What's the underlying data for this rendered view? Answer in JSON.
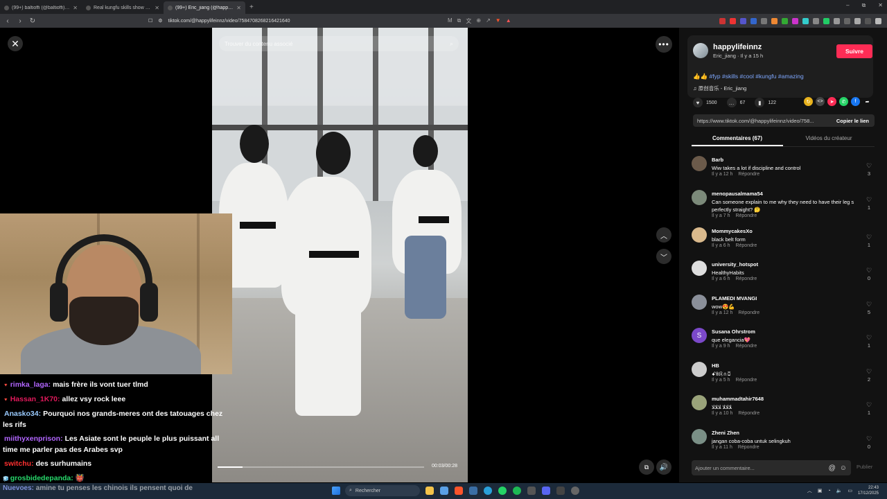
{
  "browser": {
    "tabs": [
      {
        "label": "(99+) baltioffi (@baltioffi) | TikTok",
        "active": false
      },
      {
        "label": "Real kungfu skills show 🥋 #fyp #coo",
        "active": false
      },
      {
        "label": "(99+) Eric_jiang (@happylifeinnz)",
        "active": true
      }
    ],
    "url": "tiktok.com/@happylifeinnz/video/7584708268216421640",
    "window_controls": [
      "–",
      "⧉",
      "✕"
    ]
  },
  "video": {
    "search_placeholder": "Trouver du contenu associé",
    "timecode": "00:03/00:28",
    "progress": 0.12
  },
  "controls": {
    "close": "✕",
    "more": "•••",
    "up": "︿",
    "down": "﹀",
    "volume": "🔊",
    "pip": "⧉"
  },
  "chat": {
    "messages": [
      {
        "user": "rimka_laga:",
        "text": "mais frère ils vont tuer tlmd",
        "color": "#b266ff",
        "badge": "🔻"
      },
      {
        "user": "Hassan_1K70:",
        "text": "allez vsy rock leee",
        "color": "#e0195b",
        "badge": "🔻"
      },
      {
        "user": "Anasko34:",
        "text": "Pourquoi nos grands-meres ont des tatouages chez les rifs",
        "color": "#9acbff",
        "badge": ""
      },
      {
        "user": "miithyxenprison:",
        "text": "Les Asiate sont le peuple le plus puissant all time me parler pas des Arabes svp",
        "color": "#b266ff",
        "badge": ""
      },
      {
        "user": "switchu:",
        "text": "des surhumains",
        "color": "#ff3030",
        "badge": ""
      },
      {
        "user": "grosbidedepanda:",
        "text": "👹",
        "color": "#27d86b",
        "badge": "🧊"
      }
    ],
    "overlay_user": "Nuevoes:",
    "overlay_text": "amine tu penses les chinois ils pensent quoi de"
  },
  "author": {
    "name": "happylifeinnz",
    "sub": "Eric_jiang · Il y a 15 h",
    "follow_label": "Suivre",
    "desc_prefix": "👍👍",
    "tags": [
      "#fyp",
      "#skills",
      "#cool",
      "#kungfu",
      "#amazing"
    ],
    "music": "♫  原创音乐 - Eric_jiang"
  },
  "stats": {
    "likes": "1500",
    "comments": "67",
    "saves": "122"
  },
  "share": {
    "url": "https://www.tiktok.com/@happylifeinnz/video/758...",
    "copy_label": "Copier le lien",
    "icon_colors": [
      "#e8b21d",
      "#444444",
      "#fe2c55",
      "#25d366",
      "#1877f2"
    ]
  },
  "panel_tabs": [
    "Commentaires (67)",
    "Vidéos du créateur"
  ],
  "comments": [
    {
      "user": "Barb",
      "text": "Wiw takes a lot if discipline and control",
      "time": "Il y a 12 h",
      "likes": "3",
      "avatar": "#6b5a4a",
      "initial": ""
    },
    {
      "user": "menopausalmama54",
      "text": "Can someone explain to me why they need to have their leg s perfectly straight? 🤔",
      "time": "Il y a 7 h",
      "likes": "1",
      "avatar": "#7c8a7a",
      "initial": ""
    },
    {
      "user": "MommycakesXo",
      "text": "black belt form",
      "time": "Il y a 6 h",
      "likes": "1",
      "avatar": "#d9b98c",
      "initial": ""
    },
    {
      "user": "university_hotspot",
      "text": "HealthyHabits",
      "time": "Il y a 6 h",
      "likes": "0",
      "avatar": "#dddddd",
      "initial": ""
    },
    {
      "user": "PLAMEDI MVANGI",
      "text": "wow😍💪",
      "time": "Il y a 12 h",
      "likes": "5",
      "avatar": "#8a8f99",
      "initial": ""
    },
    {
      "user": "Susana Ohrstrom",
      "text": "que elegancia💖",
      "time": "Il y a 9 h",
      "likes": "1",
      "avatar": "#7b49c9",
      "initial": "S"
    },
    {
      "user": "HB",
      "text": "ꗃꗚꗛꗝꗞ",
      "time": "Il y a 5 h",
      "likes": "2",
      "avatar": "#cccccc",
      "initial": ""
    },
    {
      "user": "muhammadtahir7648",
      "text": "ﻼﻼﻼ ﻼﻼﻼ",
      "time": "Il y a 10 h",
      "likes": "1",
      "avatar": "#9aa37a",
      "initial": ""
    },
    {
      "user": "Zheni Zhen",
      "text": "jangan coba-coba untuk selingkuh",
      "time": "Il y a 11 h",
      "likes": "0",
      "avatar": "#7a8f86",
      "initial": ""
    }
  ],
  "reply_label": "Répondre",
  "comment_input": {
    "placeholder": "Ajouter un commentaire...",
    "publish": "Publier"
  },
  "taskbar": {
    "search": "Rechercher",
    "time": "22:43",
    "date": "17/12/2025"
  }
}
